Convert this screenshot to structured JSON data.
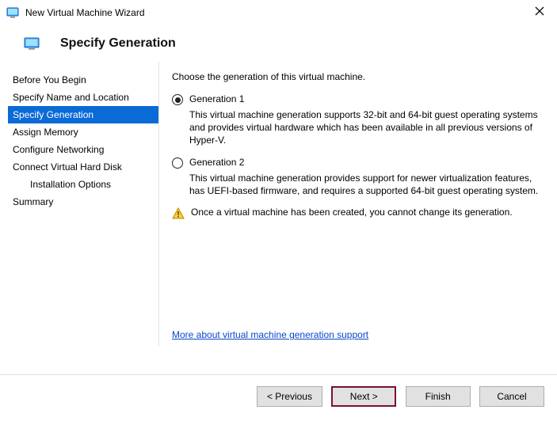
{
  "window": {
    "title": "New Virtual Machine Wizard"
  },
  "header": {
    "heading": "Specify Generation"
  },
  "sidebar": {
    "items": [
      {
        "label": "Before You Begin"
      },
      {
        "label": "Specify Name and Location"
      },
      {
        "label": "Specify Generation"
      },
      {
        "label": "Assign Memory"
      },
      {
        "label": "Configure Networking"
      },
      {
        "label": "Connect Virtual Hard Disk"
      },
      {
        "label": "Installation Options"
      },
      {
        "label": "Summary"
      }
    ]
  },
  "content": {
    "intro": "Choose the generation of this virtual machine.",
    "option1": {
      "label": "Generation 1",
      "desc": "This virtual machine generation supports 32-bit and 64-bit guest operating systems and provides virtual hardware which has been available in all previous versions of Hyper-V."
    },
    "option2": {
      "label": "Generation 2",
      "desc": "This virtual machine generation provides support for newer virtualization features, has UEFI-based firmware, and requires a supported 64-bit guest operating system."
    },
    "warning": "Once a virtual machine has been created, you cannot change its generation.",
    "help_link": "More about virtual machine generation support"
  },
  "footer": {
    "previous": "< Previous",
    "next": "Next >",
    "finish": "Finish",
    "cancel": "Cancel"
  }
}
